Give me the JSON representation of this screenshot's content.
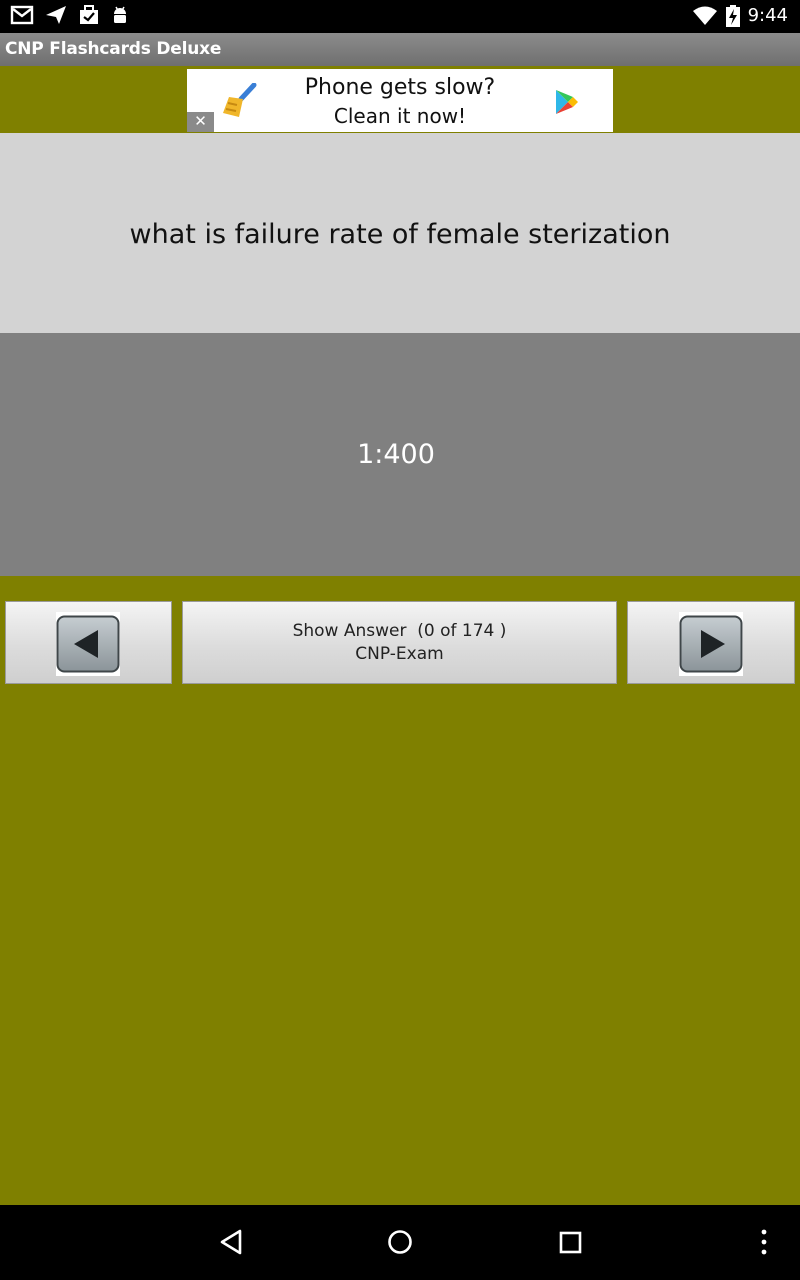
{
  "status_bar": {
    "time": "9:44",
    "icons_left": [
      "gmail-icon",
      "send-icon",
      "briefcase-icon",
      "android-icon"
    ],
    "icons_right": [
      "wifi-icon",
      "battery-charging-icon"
    ]
  },
  "app": {
    "title": "CNP Flashcards Deluxe"
  },
  "ad": {
    "line1": "Phone gets slow?",
    "line2": "Clean it now!",
    "close_label": "✕"
  },
  "card": {
    "question": "what is failure rate of female sterization",
    "answer": "1:400"
  },
  "controls": {
    "show_answer_label": "Show Answer  (0 of 174 )",
    "deck_name": "CNP-Exam"
  },
  "colors": {
    "background": "#7f8000",
    "question_bg": "#d3d3d3",
    "answer_bg": "#808080"
  }
}
